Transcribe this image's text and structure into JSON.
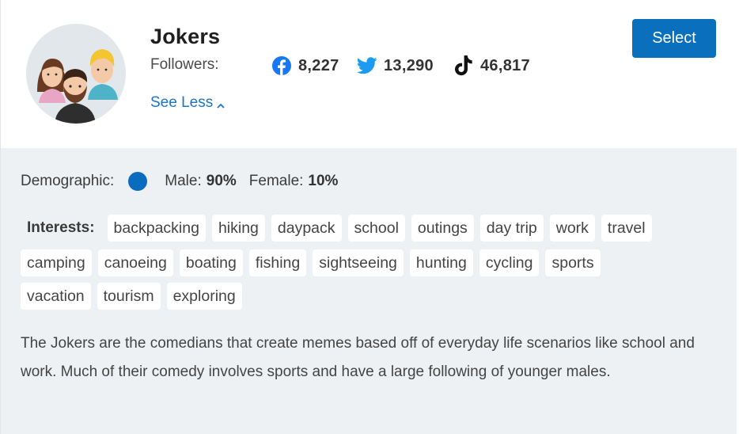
{
  "profile": {
    "name": "Jokers",
    "followers_label": "Followers:",
    "see_less_label": "See Less",
    "select_label": "Select"
  },
  "followers": {
    "facebook": "8,227",
    "twitter": "13,290",
    "tiktok": "46,817"
  },
  "icons": {
    "facebook": "facebook-icon",
    "twitter": "twitter-icon",
    "tiktok": "tiktok-icon",
    "chevron": "chevron-up-icon"
  },
  "demographic": {
    "label": "Demographic:",
    "male_label": "Male:",
    "male_value": "90%",
    "female_label": "Female:",
    "female_value": "10%",
    "male_share": 0.9
  },
  "interests": {
    "label": "Interests:",
    "rows": [
      [
        "backpacking",
        "hiking",
        "daypack",
        "school",
        "outings",
        "day trip",
        "work",
        "travel"
      ],
      [
        "camping",
        "canoeing",
        "boating",
        "fishing",
        "sightseeing",
        "hunting",
        "cycling",
        "sports"
      ],
      [
        "vacation",
        "tourism",
        "exploring"
      ]
    ]
  },
  "description": "The Jokers are the comedians that create memes based off of everyday life scenarios like school and work. Much of their comedy involves sports and have a large following of younger males.",
  "colors": {
    "accent": "#0a70be",
    "link": "#1b74c5",
    "panel_bg": "#edf1f4",
    "facebook": "#1877f2",
    "twitter": "#1d9bf0",
    "tiktok": "#111111"
  }
}
